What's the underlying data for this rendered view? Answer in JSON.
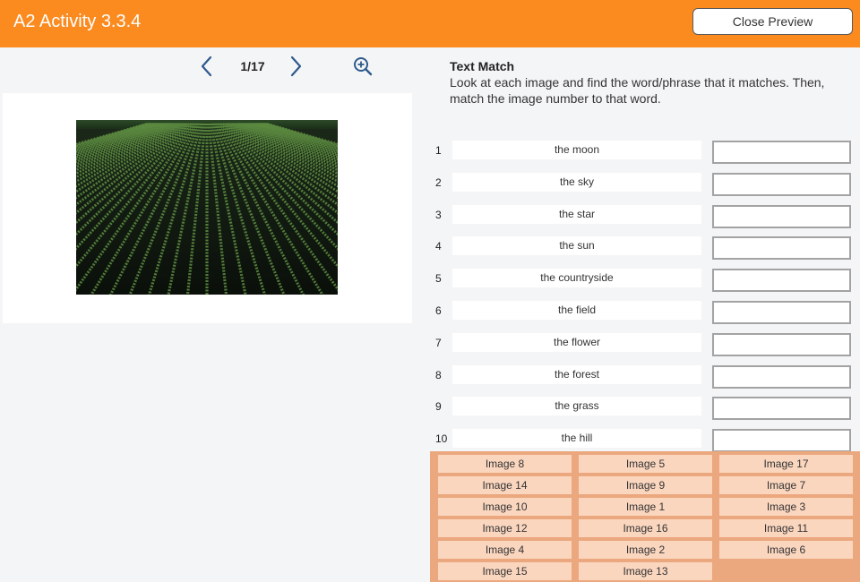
{
  "header": {
    "title": "A2 Activity 3.3.4",
    "close_label": "Close Preview"
  },
  "viewer": {
    "page_counter": "1/17",
    "icons": {
      "prev": "chevron-left-icon",
      "next": "chevron-right-icon",
      "zoom": "zoom-in-icon",
      "image": "crop-field-photo"
    }
  },
  "instructions": {
    "title": "Text Match",
    "body": "Look at each image and find the word/phrase that it matches. Then, match the image number to that word."
  },
  "rows": [
    {
      "num": "1",
      "word": "the moon",
      "answer": ""
    },
    {
      "num": "2",
      "word": "the sky",
      "answer": ""
    },
    {
      "num": "3",
      "word": "the star",
      "answer": ""
    },
    {
      "num": "4",
      "word": "the sun",
      "answer": ""
    },
    {
      "num": "5",
      "word": "the countryside",
      "answer": ""
    },
    {
      "num": "6",
      "word": "the field",
      "answer": ""
    },
    {
      "num": "7",
      "word": "the flower",
      "answer": ""
    },
    {
      "num": "8",
      "word": "the forest",
      "answer": ""
    },
    {
      "num": "9",
      "word": "the grass",
      "answer": ""
    },
    {
      "num": "10",
      "word": "the hill",
      "answer": ""
    }
  ],
  "bank": [
    "Image 8",
    "Image 5",
    "Image 17",
    "Image 14",
    "Image 9",
    "Image 7",
    "Image 10",
    "Image 1",
    "Image 3",
    "Image 12",
    "Image 16",
    "Image 11",
    "Image 4",
    "Image 2",
    "Image 6",
    "Image 15",
    "Image 13"
  ],
  "colors": {
    "header_bg": "#fb8a1f",
    "bank_bg": "#eba77d",
    "chip_bg": "#fbd6bf",
    "nav_icon": "#2d5a8c"
  }
}
